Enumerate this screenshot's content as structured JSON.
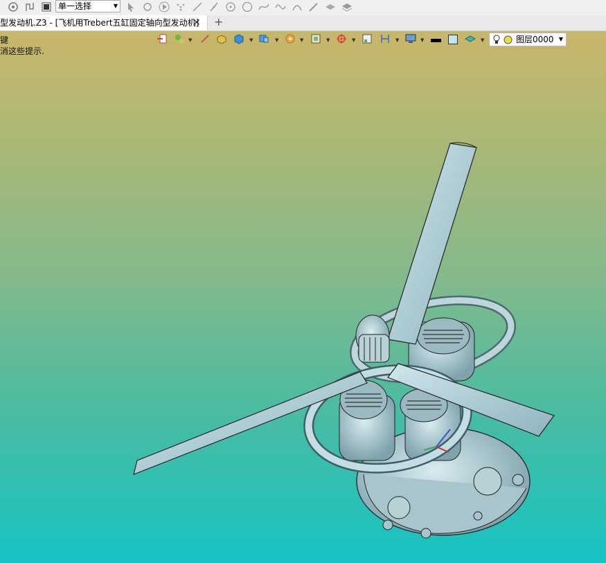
{
  "toolbar": {
    "filter_select": "单一选择",
    "icons": [
      "gear-icon",
      "path-icon",
      "stop-icon",
      "cursor-icon",
      "rotate-icon",
      "play-icon",
      "point-grid-icon",
      "line-icon",
      "slash-icon",
      "circle-point-icon",
      "circle-icon",
      "curve-icon",
      "wave-icon",
      "arc-icon",
      "pen-icon",
      "layers-icon",
      "stack-icon"
    ]
  },
  "document_tab": {
    "title": "型发动机.Z3 - [飞机用Trebert五缸固定轴向型发动机]",
    "close": "✕",
    "new_tab": "+"
  },
  "hints": {
    "line1": "键",
    "line2": "消这些提示."
  },
  "view_toolbar": {
    "layer_name": "图层0000",
    "colors": {
      "line_color": "#000000",
      "fill_color": "#bfe6f2"
    }
  },
  "model": {
    "name": "飞机用Trebert五缸固定轴向型发动机"
  }
}
